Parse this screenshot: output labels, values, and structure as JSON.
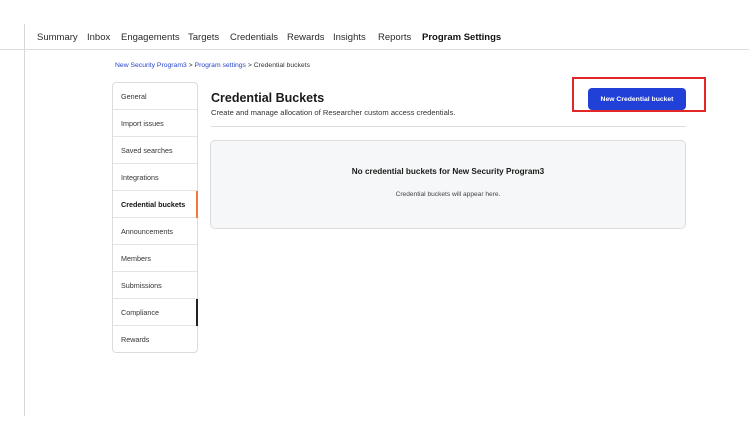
{
  "top_nav": {
    "items": [
      "Summary",
      "Inbox",
      "Engagements",
      "Targets",
      "Credentials",
      "Rewards",
      "Insights",
      "Reports",
      "Program Settings"
    ],
    "active": "Program Settings"
  },
  "breadcrumb": {
    "program": "New Security Program3",
    "separator": ">",
    "settings": "Program settings",
    "current": "Credential buckets"
  },
  "side_menu": {
    "items": [
      {
        "label": "General"
      },
      {
        "label": "Import issues"
      },
      {
        "label": "Saved searches"
      },
      {
        "label": "Integrations"
      },
      {
        "label": "Credential buckets",
        "active": true
      },
      {
        "label": "Announcements"
      },
      {
        "label": "Members"
      },
      {
        "label": "Submissions"
      },
      {
        "label": "Compliance"
      },
      {
        "label": "Rewards"
      }
    ]
  },
  "main": {
    "title": "Credential Buckets",
    "subtitle": "Create and manage allocation of Researcher custom access credentials.",
    "new_button_label": "New Credential bucket",
    "empty_state": {
      "title": "No credential buckets for New Security Program3",
      "text": "Credential buckets will appear here."
    }
  },
  "colors": {
    "primary": "#2140d8",
    "active_indicator": "#f07a3a",
    "highlight": "#e32626",
    "link": "#2844c9"
  }
}
